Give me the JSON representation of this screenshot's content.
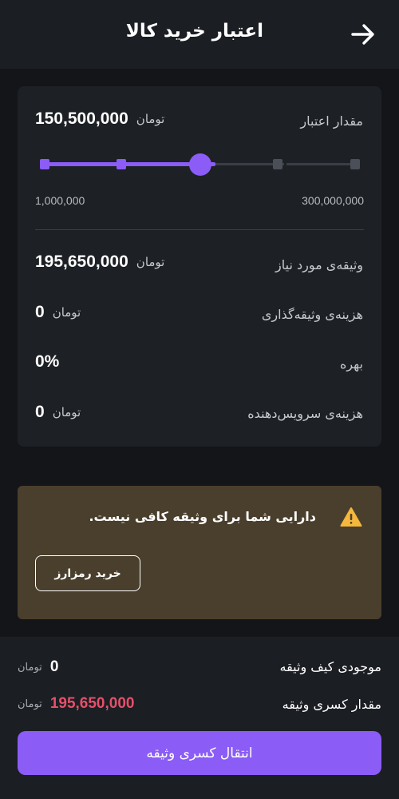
{
  "header": {
    "title": "اعتبار خرید کالا",
    "back_icon": "arrow-right-icon"
  },
  "credit": {
    "label": "مقدار اعتبار",
    "value": "150,500,000",
    "unit": "تومان",
    "slider": {
      "min_label": "1,000,000",
      "max_label": "300,000,000",
      "selected_step": 2,
      "step_count": 5
    }
  },
  "details": [
    {
      "label": "وثیقه‌ی مورد نیاز",
      "value": "195,650,000",
      "unit": "تومان"
    },
    {
      "label": "هزینه‌ی وثیقه‌گذاری",
      "value": "0",
      "unit": "تومان"
    },
    {
      "label": "بهره",
      "value": "0%",
      "unit": ""
    },
    {
      "label": "هزینه‌ی سرویس‌دهنده",
      "value": "0",
      "unit": "تومان"
    }
  ],
  "warning": {
    "message": "دارایی شما برای وثیقه کافی نیست.",
    "icon": "warning-icon",
    "button_label": "خرید رمزارز"
  },
  "footer": {
    "balance_label": "موجودی کیف وثیقه",
    "balance_value": "0",
    "balance_unit": "تومان",
    "shortfall_label": "مقدار کسری وثیقه",
    "shortfall_value": "195,650,000",
    "shortfall_unit": "تومان",
    "cta_label": "انتقال کسری وثیقه"
  },
  "colors": {
    "accent": "#8b5cf6",
    "danger": "#e5506a",
    "warning_bg": "#4a3f2c",
    "warning_icon": "#f5b83d",
    "track": "#3a3e46"
  }
}
